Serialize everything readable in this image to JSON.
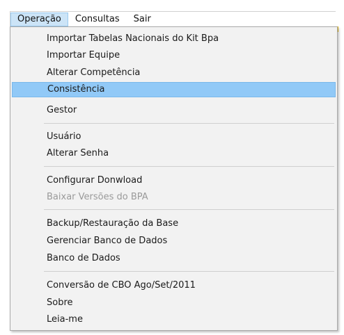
{
  "menubar": {
    "items": [
      {
        "label": "Operação"
      },
      {
        "label": "Consultas"
      },
      {
        "label": "Sair"
      }
    ]
  },
  "dropdown": {
    "items": [
      {
        "label": "Importar Tabelas Nacionais do Kit Bpa"
      },
      {
        "label": "Importar Equipe"
      },
      {
        "label": "Alterar Competência"
      },
      {
        "label": "Consistência"
      },
      {
        "label": "Gestor"
      },
      {
        "label": "Usuário"
      },
      {
        "label": "Alterar Senha"
      },
      {
        "label": "Configurar Donwload"
      },
      {
        "label": "Baixar Versões do BPA"
      },
      {
        "label": "Backup/Restauração da Base"
      },
      {
        "label": "Gerenciar Banco de Dados"
      },
      {
        "label": "Banco de Dados"
      },
      {
        "label": "Conversão de CBO Ago/Set/2011"
      },
      {
        "label": "Sobre"
      },
      {
        "label": "Leia-me"
      }
    ]
  },
  "colors": {
    "highlight": "#91c9f7",
    "active_menu": "#cce4f7",
    "disabled_text": "#9a9a9a"
  }
}
